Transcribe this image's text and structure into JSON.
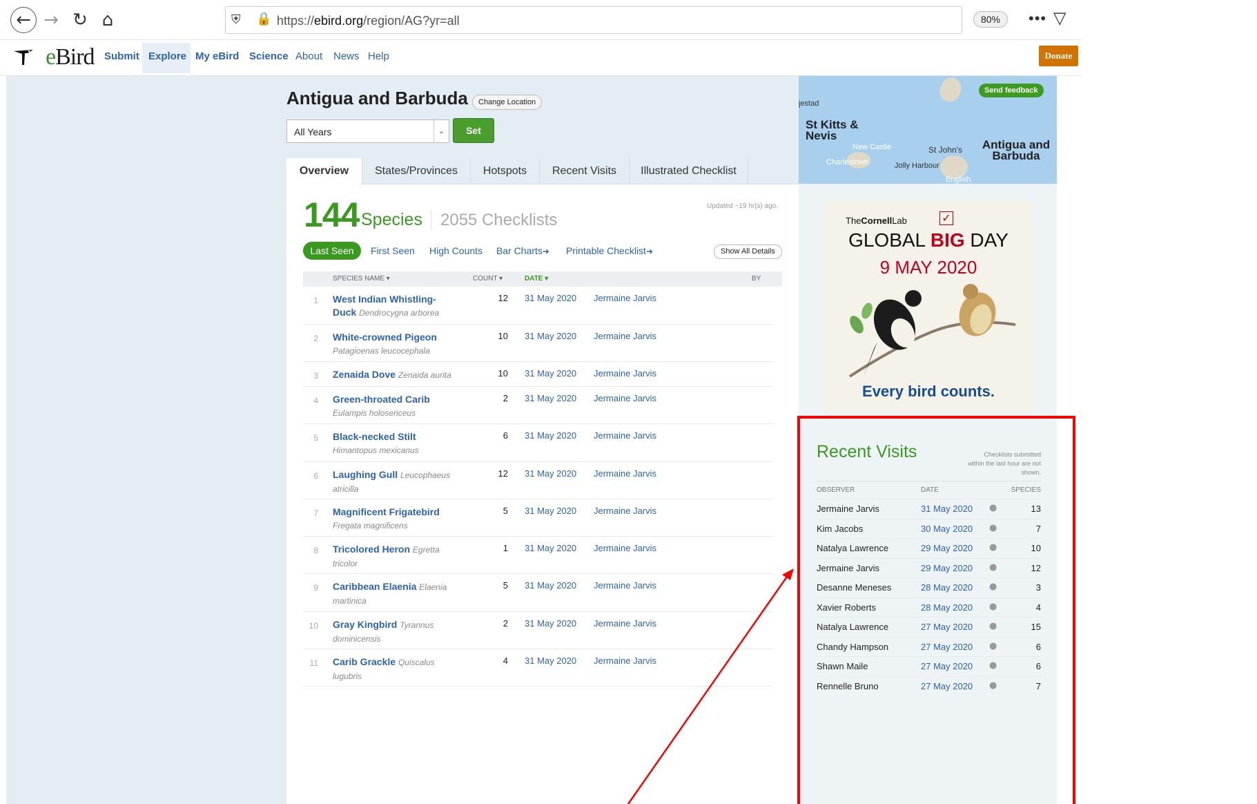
{
  "browser": {
    "url_prefix": "https://",
    "url_domain": "ebird.org",
    "url_path": "/region/AG?yr=all",
    "zoom": "80%"
  },
  "site": {
    "logo_text": "eBird",
    "nav": [
      "Submit",
      "Explore",
      "My eBird",
      "Science",
      "About",
      "News",
      "Help"
    ],
    "donate": "Donate"
  },
  "region": {
    "title": "Antigua and Barbuda",
    "change_location": "Change Location",
    "year_option": "All Years",
    "set_label": "Set"
  },
  "tabs": [
    "Overview",
    "States/Provinces",
    "Hotspots",
    "Recent Visits",
    "Illustrated Checklist"
  ],
  "summary": {
    "species_count": "144",
    "species_word": "Species",
    "checklists": "2055 Checklists",
    "updated": "Updated ~19 hr(s) ago."
  },
  "subnav": {
    "last_seen": "Last Seen",
    "links": [
      "First Seen",
      "High Counts",
      "Bar Charts",
      "Printable Checklist"
    ],
    "show_all": "Show All Details"
  },
  "table": {
    "headers": {
      "name": "SPECIES NAME",
      "count": "COUNT",
      "date": "DATE",
      "by": "BY"
    },
    "rows": [
      {
        "num": "1",
        "common": "West Indian Whistling-Duck",
        "sci": "Dendrocygna arborea",
        "count": "12",
        "date": "31 May 2020",
        "observer": "Jermaine Jarvis"
      },
      {
        "num": "2",
        "common": "White-crowned Pigeon",
        "sci": "Patagioenas leucocephala",
        "count": "10",
        "date": "31 May 2020",
        "observer": "Jermaine Jarvis"
      },
      {
        "num": "3",
        "common": "Zenaida Dove",
        "sci": "Zenaida aurita",
        "count": "10",
        "date": "31 May 2020",
        "observer": "Jermaine Jarvis"
      },
      {
        "num": "4",
        "common": "Green-throated Carib",
        "sci": "Eulampis holosericeus",
        "count": "2",
        "date": "31 May 2020",
        "observer": "Jermaine Jarvis"
      },
      {
        "num": "5",
        "common": "Black-necked Stilt",
        "sci": "Himantopus mexicanus",
        "count": "6",
        "date": "31 May 2020",
        "observer": "Jermaine Jarvis"
      },
      {
        "num": "6",
        "common": "Laughing Gull",
        "sci": "Leucophaeus atricilla",
        "count": "12",
        "date": "31 May 2020",
        "observer": "Jermaine Jarvis"
      },
      {
        "num": "7",
        "common": "Magnificent Frigatebird",
        "sci": "Fregata magnificens",
        "count": "5",
        "date": "31 May 2020",
        "observer": "Jermaine Jarvis"
      },
      {
        "num": "8",
        "common": "Tricolored Heron",
        "sci": "Egretta tricolor",
        "count": "1",
        "date": "31 May 2020",
        "observer": "Jermaine Jarvis"
      },
      {
        "num": "9",
        "common": "Caribbean Elaenia",
        "sci": "Elaenia martinica",
        "count": "5",
        "date": "31 May 2020",
        "observer": "Jermaine Jarvis"
      },
      {
        "num": "10",
        "common": "Gray Kingbird",
        "sci": "Tyrannus dominicensis",
        "count": "2",
        "date": "31 May 2020",
        "observer": "Jermaine Jarvis"
      },
      {
        "num": "11",
        "common": "Carib Grackle",
        "sci": "Quiscalus lugubris",
        "count": "4",
        "date": "31 May 2020",
        "observer": "Jermaine Jarvis"
      }
    ]
  },
  "map": {
    "labels": [
      "jestad",
      "St Kitts & Nevis",
      "New Castle",
      "Charlestown",
      "St John's",
      "Jolly Harbour",
      "English",
      "Antigua and Barbuda"
    ],
    "feedback": "Send feedback"
  },
  "ad": {
    "org_pre": "The",
    "org_bold": "Cornell",
    "org_post": "Lab",
    "line_pre": "GLOBAL ",
    "line_big": "BIG",
    "line_post": " DAY",
    "date": "9 MAY 2020",
    "tagline": "Every bird counts."
  },
  "recent_visits": {
    "title": "Recent Visits",
    "note": "Checklists submitted within the last hour are not shown.",
    "headers": {
      "observer": "OBSERVER",
      "date": "DATE",
      "species": "SPECIES"
    },
    "rows": [
      {
        "observer": "Jermaine Jarvis",
        "date": "31 May 2020",
        "species": "13"
      },
      {
        "observer": "Kim Jacobs",
        "date": "30 May 2020",
        "species": "7"
      },
      {
        "observer": "Natalya Lawrence",
        "date": "29 May 2020",
        "species": "10"
      },
      {
        "observer": "Jermaine Jarvis",
        "date": "29 May 2020",
        "species": "12"
      },
      {
        "observer": "Desanne Meneses",
        "date": "28 May 2020",
        "species": "3"
      },
      {
        "observer": "Xavier Roberts",
        "date": "28 May 2020",
        "species": "4"
      },
      {
        "observer": "Natalya Lawrence",
        "date": "27 May 2020",
        "species": "15"
      },
      {
        "observer": "Chandy Hampson",
        "date": "27 May 2020",
        "species": "6"
      },
      {
        "observer": "Shawn Maile",
        "date": "27 May 2020",
        "species": "6"
      },
      {
        "observer": "Rennelle Bruno",
        "date": "27 May 2020",
        "species": "7"
      }
    ]
  },
  "annotation_color": "#ff0000"
}
